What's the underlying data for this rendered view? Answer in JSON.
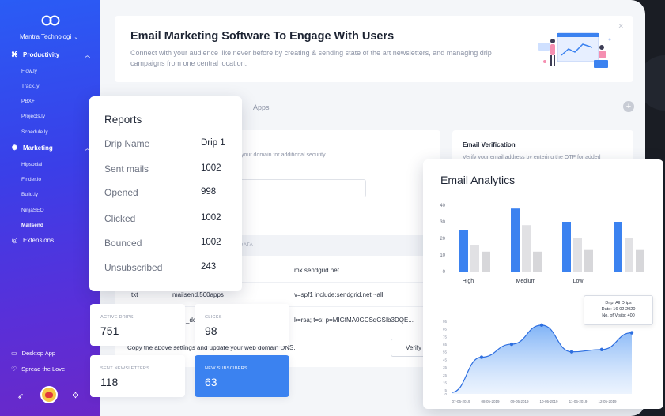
{
  "sidebar": {
    "workspace": "Mantra Technologi",
    "productivity": {
      "label": "Productivity",
      "items": [
        "Flow.ly",
        "Track.ly",
        "PBX+",
        "Projects.ly",
        "Schedule.ly"
      ]
    },
    "marketing": {
      "label": "Marketing",
      "items": [
        "Hipsocial",
        "Finder.io",
        "Build.ly",
        "NinjaSEO",
        "Mailsend"
      ],
      "active": "Mailsend"
    },
    "extensions": "Extensions",
    "footer": {
      "desktop_app": "Desktop App",
      "spread_love": "Spread the Love"
    }
  },
  "hero": {
    "title": "Email Marketing Software To Engage With Users",
    "description": "Connect with your audience like never before by creating & sending state of the art newsletters, and managing drip campaigns from one central location."
  },
  "tabs": {
    "apps": "Apps"
  },
  "domain": {
    "hint": "your domain for additional security.",
    "table_header": "DATA",
    "rows": [
      {
        "type": "",
        "host": "",
        "data": "mx.sendgrid.net."
      },
      {
        "type": "txt",
        "host": "mailsend.500apps",
        "data": "v=spf1 include:sendgrid.net ~all"
      },
      {
        "type": "",
        "host": "_dc",
        "data": "k=rsa; t=s; p=MIGfMA0GCSqGSIb3DQE..."
      }
    ],
    "note": "Copy the above settings and update your web domain DNS.",
    "verify": "Verify"
  },
  "email_verification": {
    "title": "Email Verification",
    "text": "Verify your email address by entering the OTP for added"
  },
  "reports": {
    "title": "Reports",
    "rows": [
      {
        "label": "Drip Name",
        "value": "Drip 1"
      },
      {
        "label": "Sent mails",
        "value": "1002"
      },
      {
        "label": "Opened",
        "value": "998"
      },
      {
        "label": "Clicked",
        "value": "1002"
      },
      {
        "label": "Bounced",
        "value": "1002"
      },
      {
        "label": "Unsubscribed",
        "value": "243"
      }
    ]
  },
  "stats": [
    {
      "label": "ACTIVE DRIPS",
      "value": "751"
    },
    {
      "label": "CLICKS",
      "value": "98"
    },
    {
      "label": "SENT NEWSLETTERS",
      "value": "118"
    },
    {
      "label": "NEW SUBSCIBERS",
      "value": "63"
    }
  ],
  "analytics": {
    "title": "Email Analytics",
    "tooltip": {
      "line1": "Drip: All Drips",
      "line2": "Date: 16-02-2020",
      "line3": "No. of Visits: 400"
    }
  },
  "colors": {
    "accent": "#3b82f0",
    "bar_secondary": "#dcdcdc",
    "sidebar_top": "#2a5cf5",
    "sidebar_bottom": "#6a28c8"
  },
  "chart_data": [
    {
      "type": "bar",
      "categories": [
        "High",
        "Medium",
        "Low"
      ],
      "series": [
        {
          "values": [
            25,
            38,
            30,
            30
          ]
        },
        {
          "values": [
            16,
            28,
            20,
            20
          ]
        },
        {
          "values": [
            12,
            12,
            13,
            13
          ]
        }
      ],
      "groups": 4,
      "ylim": [
        0,
        40
      ],
      "yticks": [
        "0",
        "10",
        "20",
        "30",
        "40"
      ]
    },
    {
      "type": "area",
      "x": [
        "07-05-2019",
        "08-05-2019",
        "09-05-2019",
        "10-05-2019",
        "11-05-2019",
        "12-05-2019"
      ],
      "values": [
        2,
        48,
        65,
        90,
        55,
        58,
        80
      ],
      "ylim": [
        0,
        95
      ],
      "yticks": [
        "0",
        "5",
        "15",
        "25",
        "35",
        "45",
        "55",
        "65",
        "75",
        "85",
        "95"
      ]
    }
  ]
}
